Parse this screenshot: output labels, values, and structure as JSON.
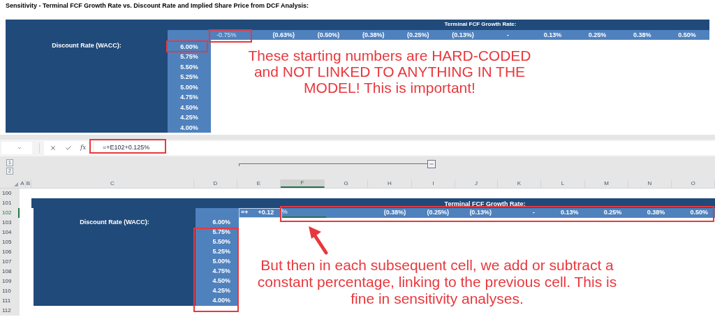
{
  "title": "Sensitivity - Terminal FCF Growth Rate vs. Discount Rate and Implied Share Price from DCF Analysis:",
  "top_table": {
    "header": "Terminal FCF Growth Rate:",
    "growth_rates": [
      "-0.75%",
      "(0.63%)",
      "(0.50%)",
      "(0.38%)",
      "(0.25%)",
      "(0.13%)",
      "-",
      "0.13%",
      "0.25%",
      "0.38%",
      "0.50%"
    ],
    "row_label": "Discount Rate (WACC):",
    "discount_rates": [
      "6.00%",
      "5.75%",
      "5.50%",
      "5.25%",
      "5.00%",
      "4.75%",
      "4.50%",
      "4.25%",
      "4.00%"
    ]
  },
  "top_note": "These starting numbers are HARD-CODED and NOT LINKED TO ANYTHING IN THE MODEL! This is important!",
  "formula_bar": {
    "function_label": "fx",
    "formula": "=+E102+0.125%"
  },
  "outline_levels": [
    "1",
    "2"
  ],
  "columns": [
    {
      "label": "A",
      "selected": false
    },
    {
      "label": "B",
      "selected": false
    },
    {
      "label": "C",
      "selected": false
    },
    {
      "label": "D",
      "selected": false
    },
    {
      "label": "E",
      "selected": false
    },
    {
      "label": "F",
      "selected": true
    },
    {
      "label": "G",
      "selected": false
    },
    {
      "label": "H",
      "selected": false
    },
    {
      "label": "I",
      "selected": false
    },
    {
      "label": "J",
      "selected": false
    },
    {
      "label": "K",
      "selected": false
    },
    {
      "label": "L",
      "selected": false
    },
    {
      "label": "M",
      "selected": false
    },
    {
      "label": "N",
      "selected": false
    },
    {
      "label": "O",
      "selected": false
    }
  ],
  "rows": [
    {
      "label": "100",
      "selected": false
    },
    {
      "label": "101",
      "selected": false
    },
    {
      "label": "102",
      "selected": true
    },
    {
      "label": "103",
      "selected": false
    },
    {
      "label": "104",
      "selected": false
    },
    {
      "label": "105",
      "selected": false
    },
    {
      "label": "106",
      "selected": false
    },
    {
      "label": "107",
      "selected": false
    },
    {
      "label": "108",
      "selected": false
    },
    {
      "label": "109",
      "selected": false
    },
    {
      "label": "110",
      "selected": false
    },
    {
      "label": "111",
      "selected": false
    },
    {
      "label": "112",
      "selected": false
    }
  ],
  "sheet_table": {
    "header": "Terminal FCF Growth Rate:",
    "editing_cell": [
      "=+",
      "+0.12"
    ],
    "editing_overflow": "%",
    "growth_rates": [
      "(0.38%)",
      "(0.25%)",
      "(0.13%)",
      "-",
      "0.13%",
      "0.25%",
      "0.38%",
      "0.50%"
    ],
    "row_label": "Discount Rate (WACC):",
    "discount_rates": [
      "6.00%",
      "5.75%",
      "5.50%",
      "5.25%",
      "5.00%",
      "4.75%",
      "4.50%",
      "4.25%",
      "4.00%"
    ]
  },
  "bottom_note": "But then in each subsequent cell, we add or subtract a constant percentage, linking to the previous cell. This is fine in sensitivity analyses."
}
